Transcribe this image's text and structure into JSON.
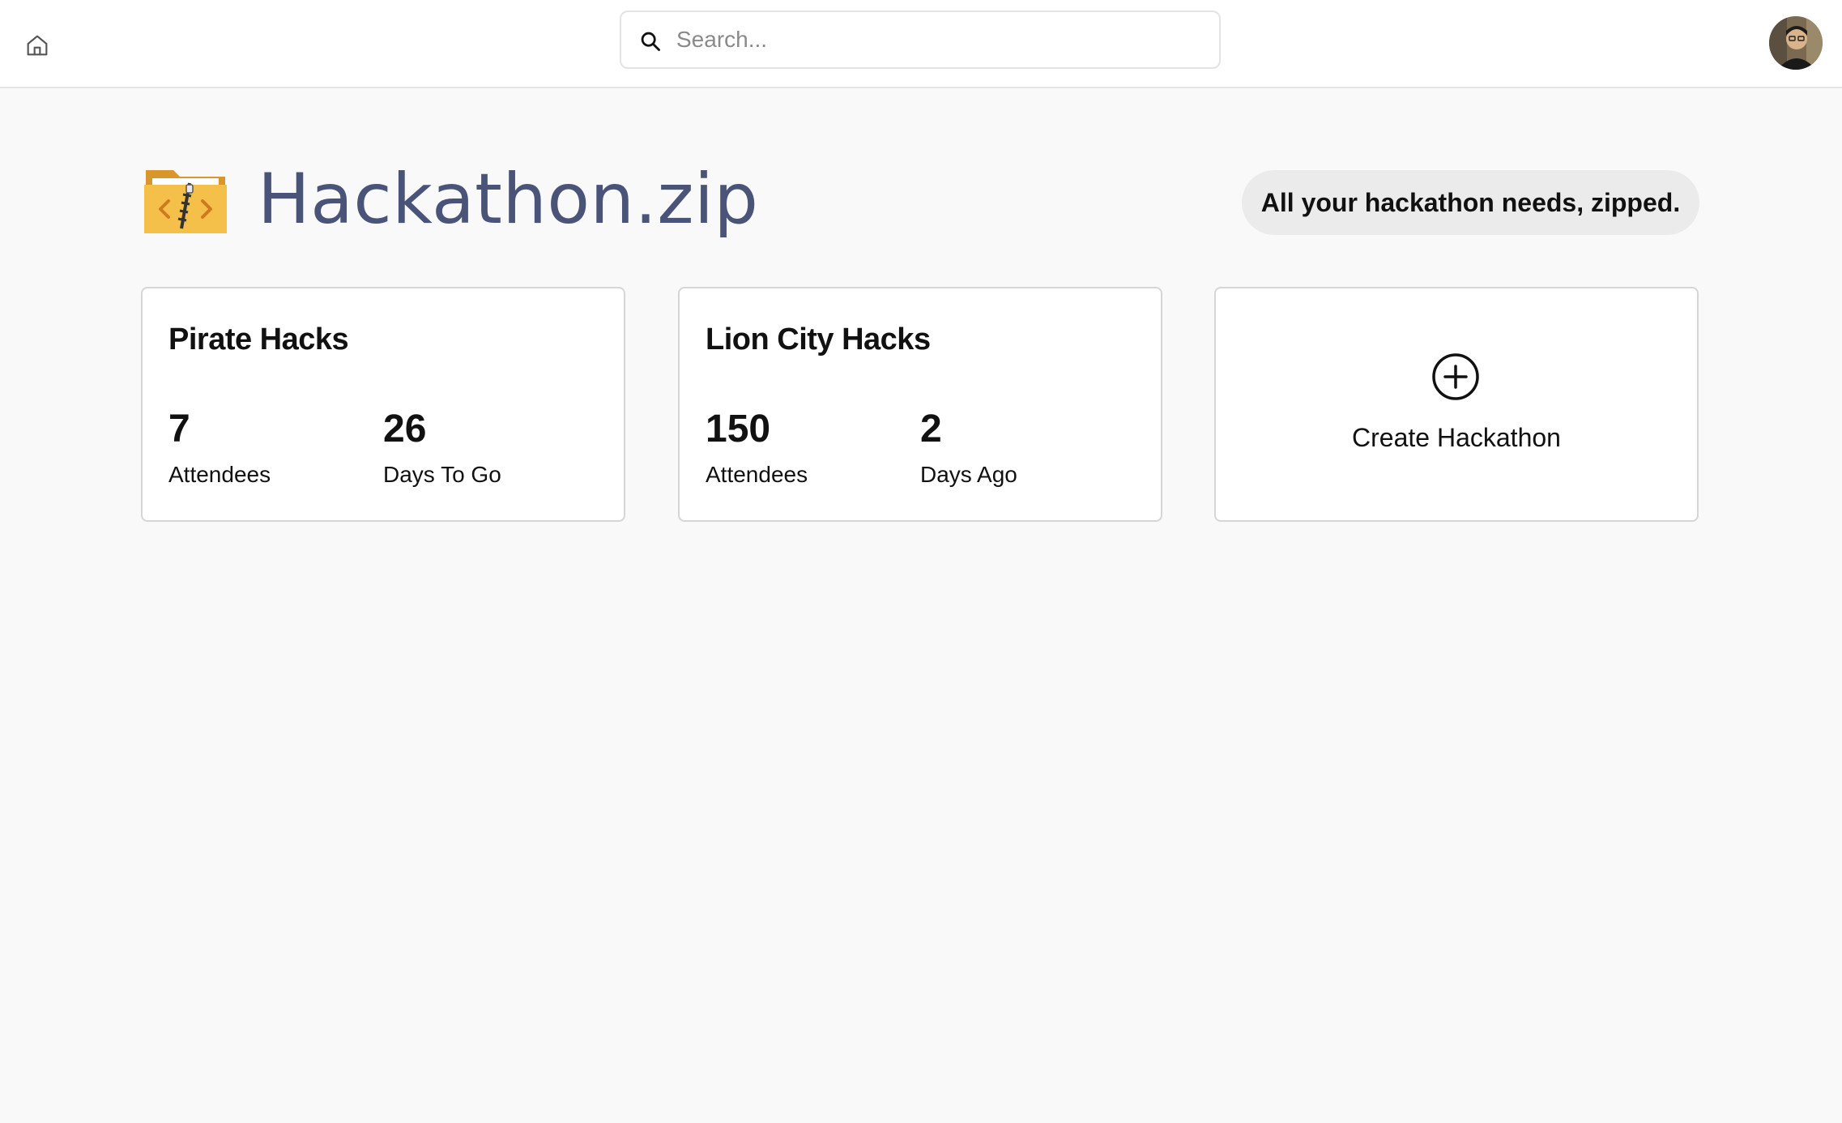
{
  "header": {
    "home_icon": "home-icon",
    "search": {
      "placeholder": "Search...",
      "value": "",
      "icon": "search-icon"
    },
    "avatar_icon": "user-avatar"
  },
  "hero": {
    "logo_icon": "zip-folder-icon",
    "title": "Hackathon.zip",
    "tagline": "All your hackathon needs, zipped."
  },
  "hackathons": [
    {
      "name": "Pirate Hacks",
      "stats": [
        {
          "value": "7",
          "label": "Attendees"
        },
        {
          "value": "26",
          "label": "Days To Go"
        }
      ]
    },
    {
      "name": "Lion City Hacks",
      "stats": [
        {
          "value": "150",
          "label": "Attendees"
        },
        {
          "value": "2",
          "label": "Days Ago"
        }
      ]
    }
  ],
  "create": {
    "label": "Create Hackathon",
    "icon": "plus-circle-icon"
  },
  "colors": {
    "title": "#4a5478",
    "folder": "#f5c04a",
    "background": "#f9f9f9",
    "card_border": "#d6d6d6"
  }
}
